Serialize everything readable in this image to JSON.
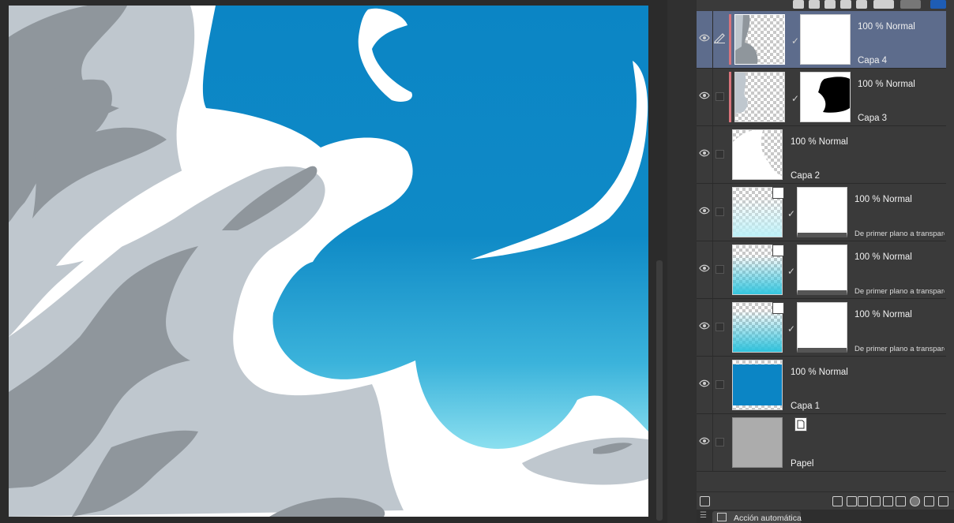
{
  "layers": [
    {
      "id": "capa4",
      "mode": "100 % Normal",
      "name": "Capa 4",
      "selected": true,
      "has_mask": true,
      "thumb": "capa4-thumb",
      "mask": "white"
    },
    {
      "id": "capa3",
      "mode": "100 % Normal",
      "name": "Capa 3",
      "selected": false,
      "has_mask": true,
      "thumb": "capa3-thumb",
      "mask": "black-shape"
    },
    {
      "id": "capa2",
      "mode": "100 % Normal",
      "name": "Capa 2",
      "selected": false,
      "has_mask": false,
      "thumb": "capa2-thumb"
    },
    {
      "id": "grad1",
      "mode": "100 % Normal",
      "name": "De primer plano a transparente",
      "selected": false,
      "has_mask": true,
      "thumb": "gradient-thumb"
    },
    {
      "id": "grad2",
      "mode": "100 % Normal",
      "name": "De primer plano a transparente",
      "selected": false,
      "has_mask": true,
      "thumb": "gradient-thumb"
    },
    {
      "id": "grad3",
      "mode": "100 % Normal",
      "name": "De primer plano a transparente",
      "selected": false,
      "has_mask": true,
      "thumb": "gradient-thumb"
    },
    {
      "id": "capa1",
      "mode": "100 % Normal",
      "name": "Capa 1",
      "selected": false,
      "has_mask": false,
      "thumb": "blue-thumb"
    },
    {
      "id": "papel",
      "mode": "",
      "name": "Papel",
      "selected": false,
      "has_mask": false,
      "thumb": "paper-thumb"
    }
  ],
  "bottom_bar": {
    "auto_action_label": "Acción automática"
  },
  "colors": {
    "sky_top": "#0b85c5",
    "sky_bottom": "#9be8f3",
    "cloud_gray": "#bfc7ce",
    "shadow_gray": "#8f969c",
    "selected_row": "#5d6c8c"
  }
}
